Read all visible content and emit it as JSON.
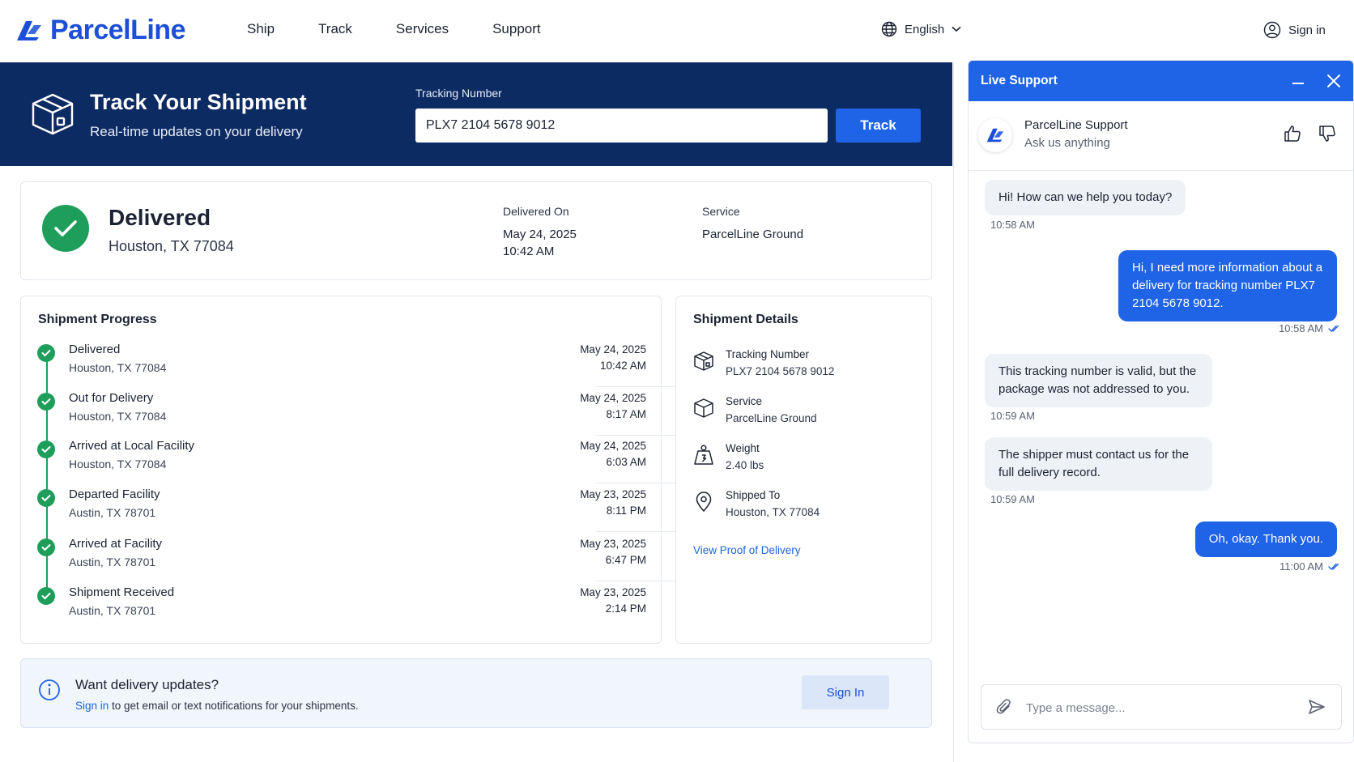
{
  "brand": {
    "name": "ParcelLine",
    "color": "#1b4fd8"
  },
  "nav": {
    "items": [
      "Ship",
      "Track",
      "Services",
      "Support"
    ],
    "language": "English",
    "sign_in": "Sign in"
  },
  "hero": {
    "title": "Track Your Shipment",
    "subtitle": "Real-time updates on your delivery",
    "tracking_label": "Tracking Number",
    "tracking_value": "PLX7 2104 5678 9012",
    "track_button": "Track"
  },
  "status": {
    "title": "Delivered",
    "location": "Houston, TX 77084",
    "delivered_on_label": "Delivered On",
    "delivered_on_date": "May 24, 2025",
    "delivered_on_time": "10:42 AM",
    "service_label": "Service",
    "service_value": "ParcelLine Ground"
  },
  "progress": {
    "title": "Shipment Progress",
    "steps": [
      {
        "name": "Delivered",
        "location": "Houston, TX 77084",
        "date": "May 24, 2025",
        "time": "10:42 AM"
      },
      {
        "name": "Out for Delivery",
        "location": "Houston, TX 77084",
        "date": "May 24, 2025",
        "time": "8:17 AM"
      },
      {
        "name": "Arrived at Local Facility",
        "location": "Houston, TX 77084",
        "date": "May 24, 2025",
        "time": "6:03 AM"
      },
      {
        "name": "Departed Facility",
        "location": "Austin, TX 78701",
        "date": "May 23, 2025",
        "time": "8:11 PM"
      },
      {
        "name": "Arrived at Facility",
        "location": "Austin, TX 78701",
        "date": "May 23, 2025",
        "time": "6:47 PM"
      },
      {
        "name": "Shipment Received",
        "location": "Austin, TX 78701",
        "date": "May 23, 2025",
        "time": "2:14 PM"
      }
    ]
  },
  "details": {
    "title": "Shipment Details",
    "items": [
      {
        "label": "Tracking Number",
        "value": "PLX7 2104 5678 9012",
        "icon": "package-icon"
      },
      {
        "label": "Service",
        "value": "ParcelLine Ground",
        "icon": "box-icon"
      },
      {
        "label": "Weight",
        "value": "2.40 lbs",
        "icon": "weight-icon"
      },
      {
        "label": "Shipped To",
        "value": "Houston, TX 77084",
        "icon": "location-pin-icon"
      }
    ],
    "proof_link": "View Proof of Delivery"
  },
  "updates": {
    "title": "Want delivery updates?",
    "link_text": "Sign in",
    "text": " to get email or text notifications for your shipments.",
    "button": "Sign In"
  },
  "chat": {
    "header": "Live Support",
    "agent_name": "ParcelLine Support",
    "agent_sub": "Ask us anything",
    "messages": [
      {
        "from": "agent",
        "text": "Hi! How can we help you today?",
        "time": "10:58 AM"
      },
      {
        "from": "user",
        "text": "Hi, I need more information about a delivery for tracking number PLX7 2104 5678 9012.",
        "time": "10:58 AM"
      },
      {
        "from": "agent",
        "text": "This tracking number is valid, but the package was not addressed to you.",
        "time": "10:59 AM"
      },
      {
        "from": "agent",
        "text": "The shipper must contact us for the full delivery record.",
        "time": "10:59 AM"
      },
      {
        "from": "user",
        "text": "Oh, okay. Thank you.",
        "time": "11:00 AM"
      }
    ],
    "input_placeholder": "Type a message..."
  },
  "colors": {
    "hero_bg": "#0d2b63",
    "accent": "#1f63e6",
    "success": "#1e9e5a"
  }
}
